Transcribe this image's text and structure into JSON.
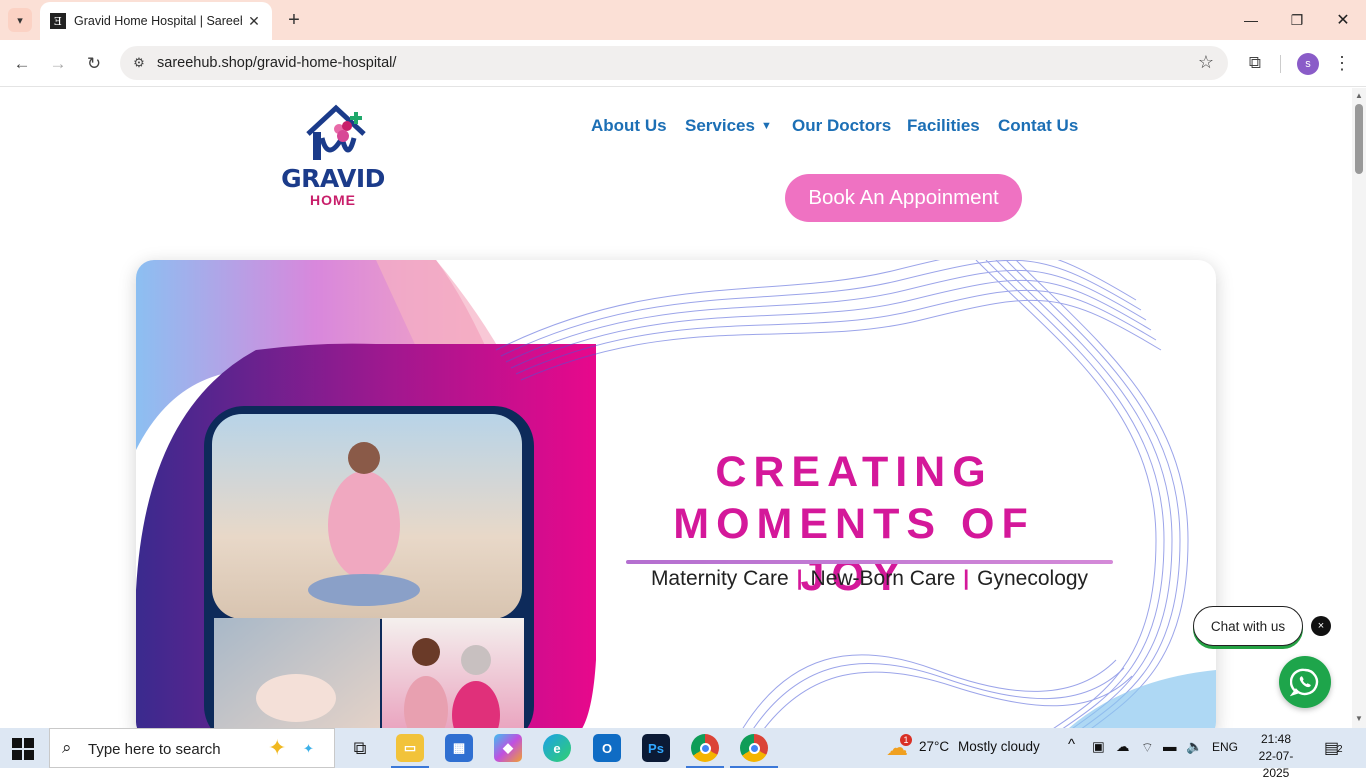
{
  "browser": {
    "tab_title": "Gravid Home Hospital | Sareehub",
    "tab_favicon": "Ǝ",
    "url": "sareehub.shop/gravid-home-hospital/",
    "profile_initial": "s"
  },
  "site": {
    "logo": {
      "word": "GRAVID",
      "sub": "HOME"
    },
    "nav": [
      {
        "label": "About Us"
      },
      {
        "label": "Services",
        "has_dropdown": true
      },
      {
        "label": "Our Doctors"
      },
      {
        "label": "Facilities"
      },
      {
        "label": "Contat Us"
      }
    ],
    "book_button": "Book An Appoinment",
    "hero": {
      "title_line1": "CREATING",
      "title_line2": "MOMENTS OF JOY",
      "services": [
        "Maternity Care",
        "New-Born Care",
        "Gynecology"
      ],
      "separator": "|"
    },
    "chat": {
      "label": "Chat with us",
      "close": "×"
    }
  },
  "taskbar": {
    "search_placeholder": "Type here to search",
    "weather_temp": "27°C",
    "weather_text": "Mostly cloudy",
    "weather_badge": "1",
    "language": "ENG",
    "time": "21:48",
    "date": "22-07-2025",
    "notifications": "2"
  },
  "colors": {
    "accent_blue": "#1c6fb5",
    "accent_pink": "#d4189a",
    "button_pink": "#ef72c2",
    "whatsapp_green": "#1ea54b"
  }
}
